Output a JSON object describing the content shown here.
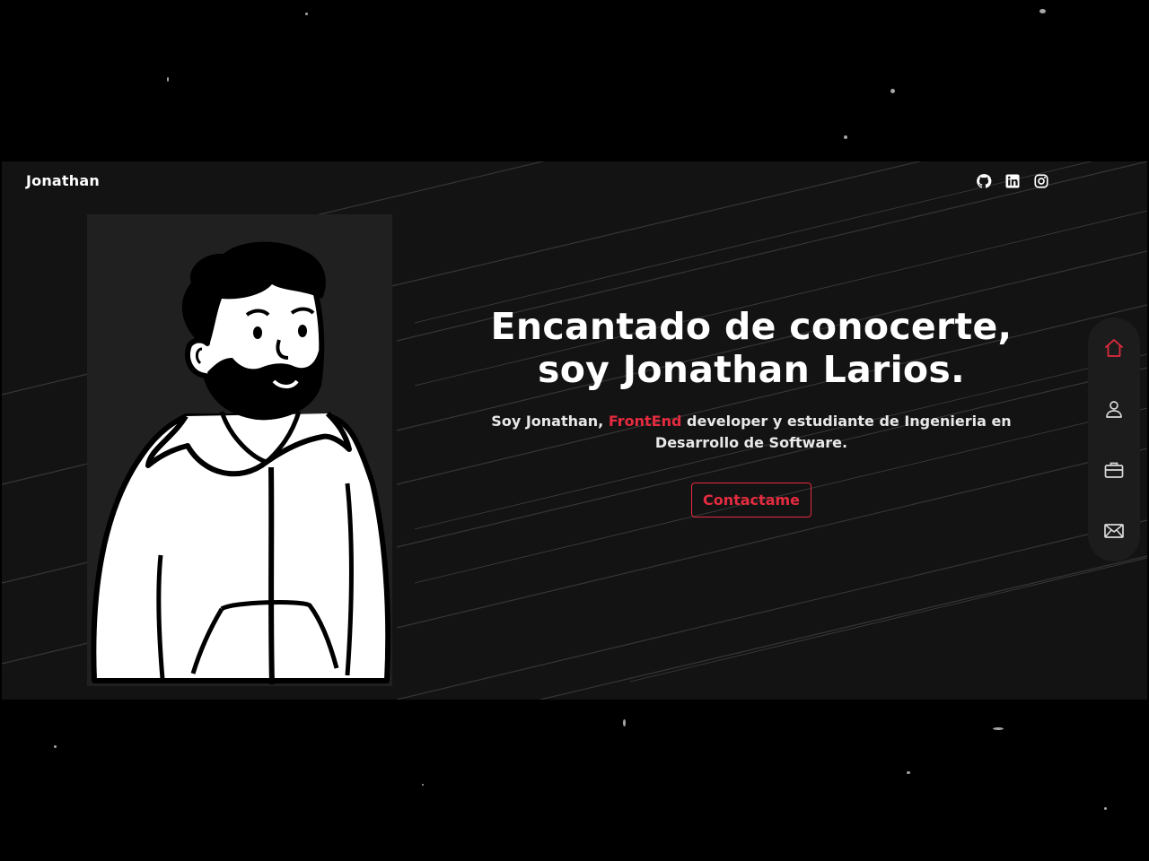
{
  "header": {
    "brand": "Jonathan",
    "social_links": [
      {
        "icon": "github-icon",
        "name": "GitHub"
      },
      {
        "icon": "linkedin-icon",
        "name": "LinkedIn"
      },
      {
        "icon": "instagram-icon",
        "name": "Instagram"
      }
    ]
  },
  "hero": {
    "title_line1": "Encantado de conocerte,",
    "title_line2": "soy Jonathan Larios.",
    "text_before": "Soy Jonathan, ",
    "text_highlight": "FrontEnd",
    "text_after": " developer y estudiante de Ingenieria en Desarrollo de Software.",
    "cta_label": "Contactame"
  },
  "side_nav": [
    {
      "icon": "home-icon",
      "active": true
    },
    {
      "icon": "user-icon",
      "active": false
    },
    {
      "icon": "briefcase-icon",
      "active": false
    },
    {
      "icon": "mail-icon",
      "active": false
    }
  ],
  "colors": {
    "accent": "#e52b3f",
    "panel_background": "#131313",
    "page_background": "#000000",
    "text": "#ffffff"
  }
}
